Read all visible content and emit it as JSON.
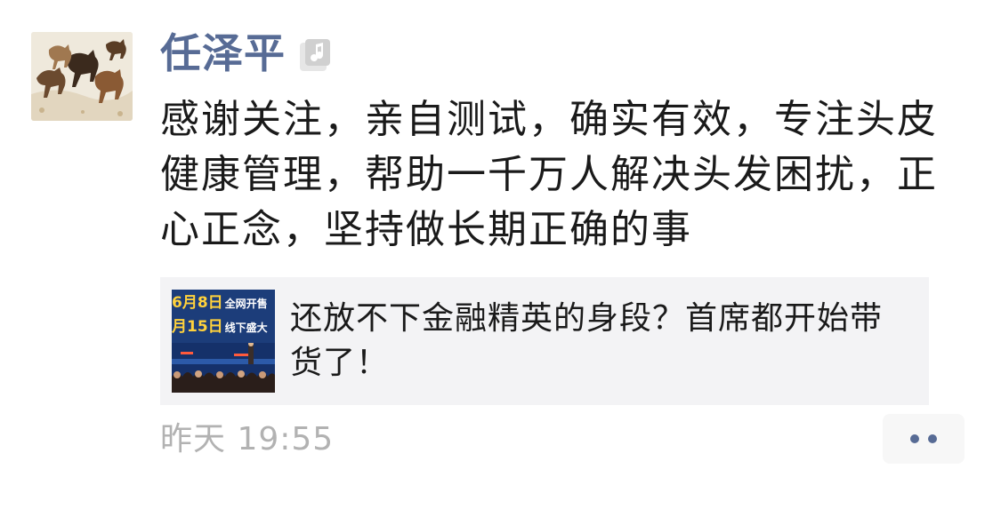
{
  "post": {
    "author": "任泽平",
    "text": "感谢关注，亲自测试，确实有效，专注头皮健康管理，帮助一千万人解决头发困扰，正心正念，坚持做长期正确的事",
    "link_card": {
      "title": "还放不下金融精英的身段？首席都开始带货了！",
      "thumbnail": {
        "line1_date": "6月8日",
        "line1_text": "全网开售",
        "line2_date": "月15日",
        "line2_text": "线下盛大"
      }
    },
    "timestamp": "昨天 19:55",
    "avatar_icon": "horses-painting-avatar",
    "badge_icon": "music-note-badge-icon",
    "more_icon": "more-dots-icon"
  },
  "colors": {
    "author_name": "#576b95",
    "timestamp": "#b2b2b2",
    "card_bg": "#f3f3f5",
    "thumb_highlight": "#ffd23c"
  }
}
